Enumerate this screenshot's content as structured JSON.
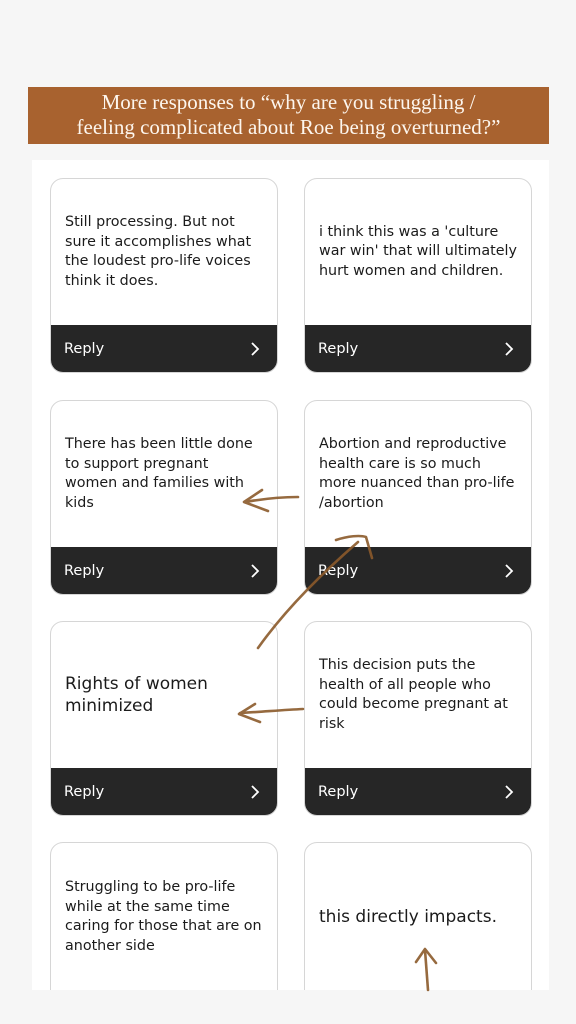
{
  "header": {
    "line1": "More responses to “why are you struggling /",
    "line2": "feeling complicated about Roe being overturned?”"
  },
  "colors": {
    "banner_bg": "#a8622f",
    "reply_bar": "#262626",
    "arrow_ink": "#8b5a2b"
  },
  "reply_label": "Reply",
  "cards": [
    {
      "text": "Still processing. But not sure it accomplishes what the loudest pro-life voices think it does."
    },
    {
      "text": "i think this was a 'culture war win' that will ultimately hurt women and children."
    },
    {
      "text": "There has been little done to support pregnant women and families with kids"
    },
    {
      "text": "Abortion and reproductive health care is so much more nuanced than pro-life /abortion"
    },
    {
      "text": "Rights of women minimized"
    },
    {
      "text": "This decision puts the health of all people who could become pregnant at risk"
    },
    {
      "text": "Struggling to be pro-life while at the same time caring for those that are on another side"
    },
    {
      "text": "this directly impacts."
    }
  ],
  "icons": {
    "reply_chevron": "chevron-right-icon",
    "annotation": "hand-drawn-arrow-icon"
  }
}
